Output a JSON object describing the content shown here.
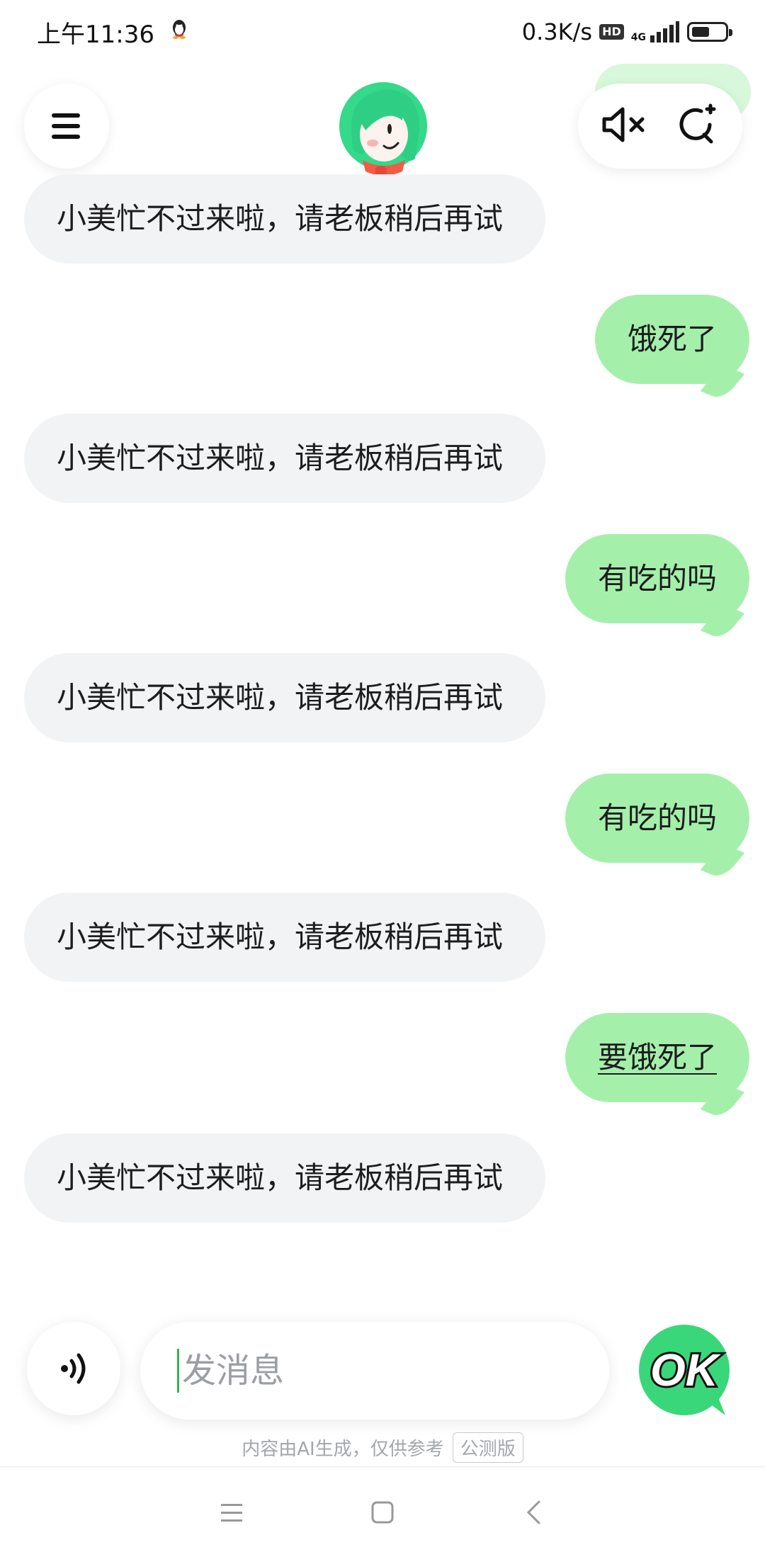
{
  "status_bar": {
    "time": "上午11:36",
    "network_speed": "0.3K/s",
    "hd_badge": "HD",
    "network_type": "4G",
    "battery_level": 0.55
  },
  "header": {
    "menu_icon": "hamburger-menu-icon",
    "avatar_icon": "assistant-avatar-icon",
    "mute_icon": "speaker-muted-icon",
    "new_chat_icon": "new-chat-icon"
  },
  "messages": [
    {
      "role": "bot",
      "text": "小美忙不过来啦，请老板稍后再试"
    },
    {
      "role": "user",
      "text": "饿死了"
    },
    {
      "role": "bot",
      "text": "小美忙不过来啦，请老板稍后再试"
    },
    {
      "role": "user",
      "text": "有吃的吗"
    },
    {
      "role": "bot",
      "text": "小美忙不过来啦，请老板稍后再试"
    },
    {
      "role": "user",
      "text": "有吃的吗"
    },
    {
      "role": "bot",
      "text": "小美忙不过来啦，请老板稍后再试"
    },
    {
      "role": "user",
      "text": "要饿死了"
    },
    {
      "role": "bot",
      "text": "小美忙不过来啦，请老板稍后再试"
    }
  ],
  "composer": {
    "voice_icon": "voice-input-icon",
    "placeholder": "发消息",
    "value": "",
    "send_label": "OK"
  },
  "footer": {
    "disclaimer": "内容由AI生成，仅供参考",
    "beta_badge": "公测版"
  },
  "nav": {
    "menu_icon": "recent-apps-icon",
    "home_icon": "home-icon",
    "back_icon": "back-icon"
  },
  "colors": {
    "user_bubble": "#a4f0ab",
    "bot_bubble": "#f2f3f5",
    "accent_green": "#3ad77a"
  }
}
